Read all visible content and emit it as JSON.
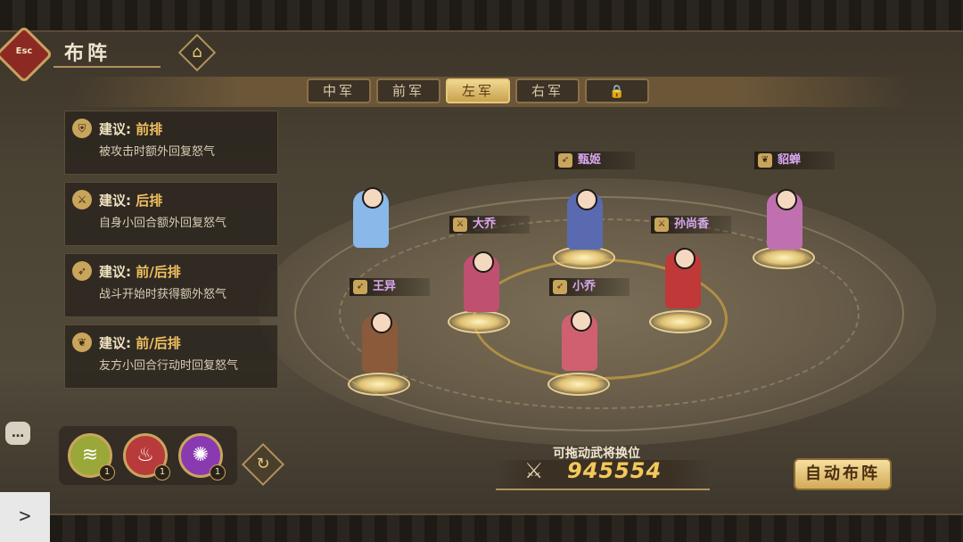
{
  "header": {
    "esc_label": "Esc",
    "title": "布阵",
    "home_icon": "home-icon"
  },
  "tabs": [
    {
      "label": "中军",
      "active": false
    },
    {
      "label": "前军",
      "active": false
    },
    {
      "label": "左军",
      "active": true
    },
    {
      "label": "右军",
      "active": false
    },
    {
      "label": "",
      "icon": "lock-icon",
      "active": false
    }
  ],
  "suggestions": [
    {
      "head": "建议:",
      "position": "前排",
      "desc": "被攻击时额外回复怒气",
      "icon": "shield-icon"
    },
    {
      "head": "建议:",
      "position": "后排",
      "desc": "自身小回合额外回复怒气",
      "icon": "sword-icon"
    },
    {
      "head": "建议:",
      "position": "前/后排",
      "desc": "战斗开始时获得额外怒气",
      "icon": "spear-icon"
    },
    {
      "head": "建议:",
      "position": "前/后排",
      "desc": "友方小回合行动时回复怒气",
      "icon": "leaf-icon"
    }
  ],
  "heroes": [
    {
      "name": "",
      "color": "#8ab8e8"
    },
    {
      "name": "甄姬",
      "color": "#5a6ab0"
    },
    {
      "name": "貂蝉",
      "color": "#c070b0"
    },
    {
      "name": "大乔",
      "color": "#c05070"
    },
    {
      "name": "孙尚香",
      "color": "#c03838"
    },
    {
      "name": "王异",
      "color": "#8a5a3a"
    },
    {
      "name": "小乔",
      "color": "#d06070"
    }
  ],
  "skills": [
    {
      "icon": "wind-icon",
      "level": "1",
      "color": "#9aa83a"
    },
    {
      "icon": "fire-icon",
      "level": "1",
      "color": "#b83a3a"
    },
    {
      "icon": "swirl-icon",
      "level": "1",
      "color": "#8a3ab0"
    }
  ],
  "battle": {
    "drag_hint": "可拖动武将换位",
    "power": "945554",
    "auto_button": "自动布阵"
  },
  "chat_icon": "chat-icon",
  "side_arrow": ">"
}
